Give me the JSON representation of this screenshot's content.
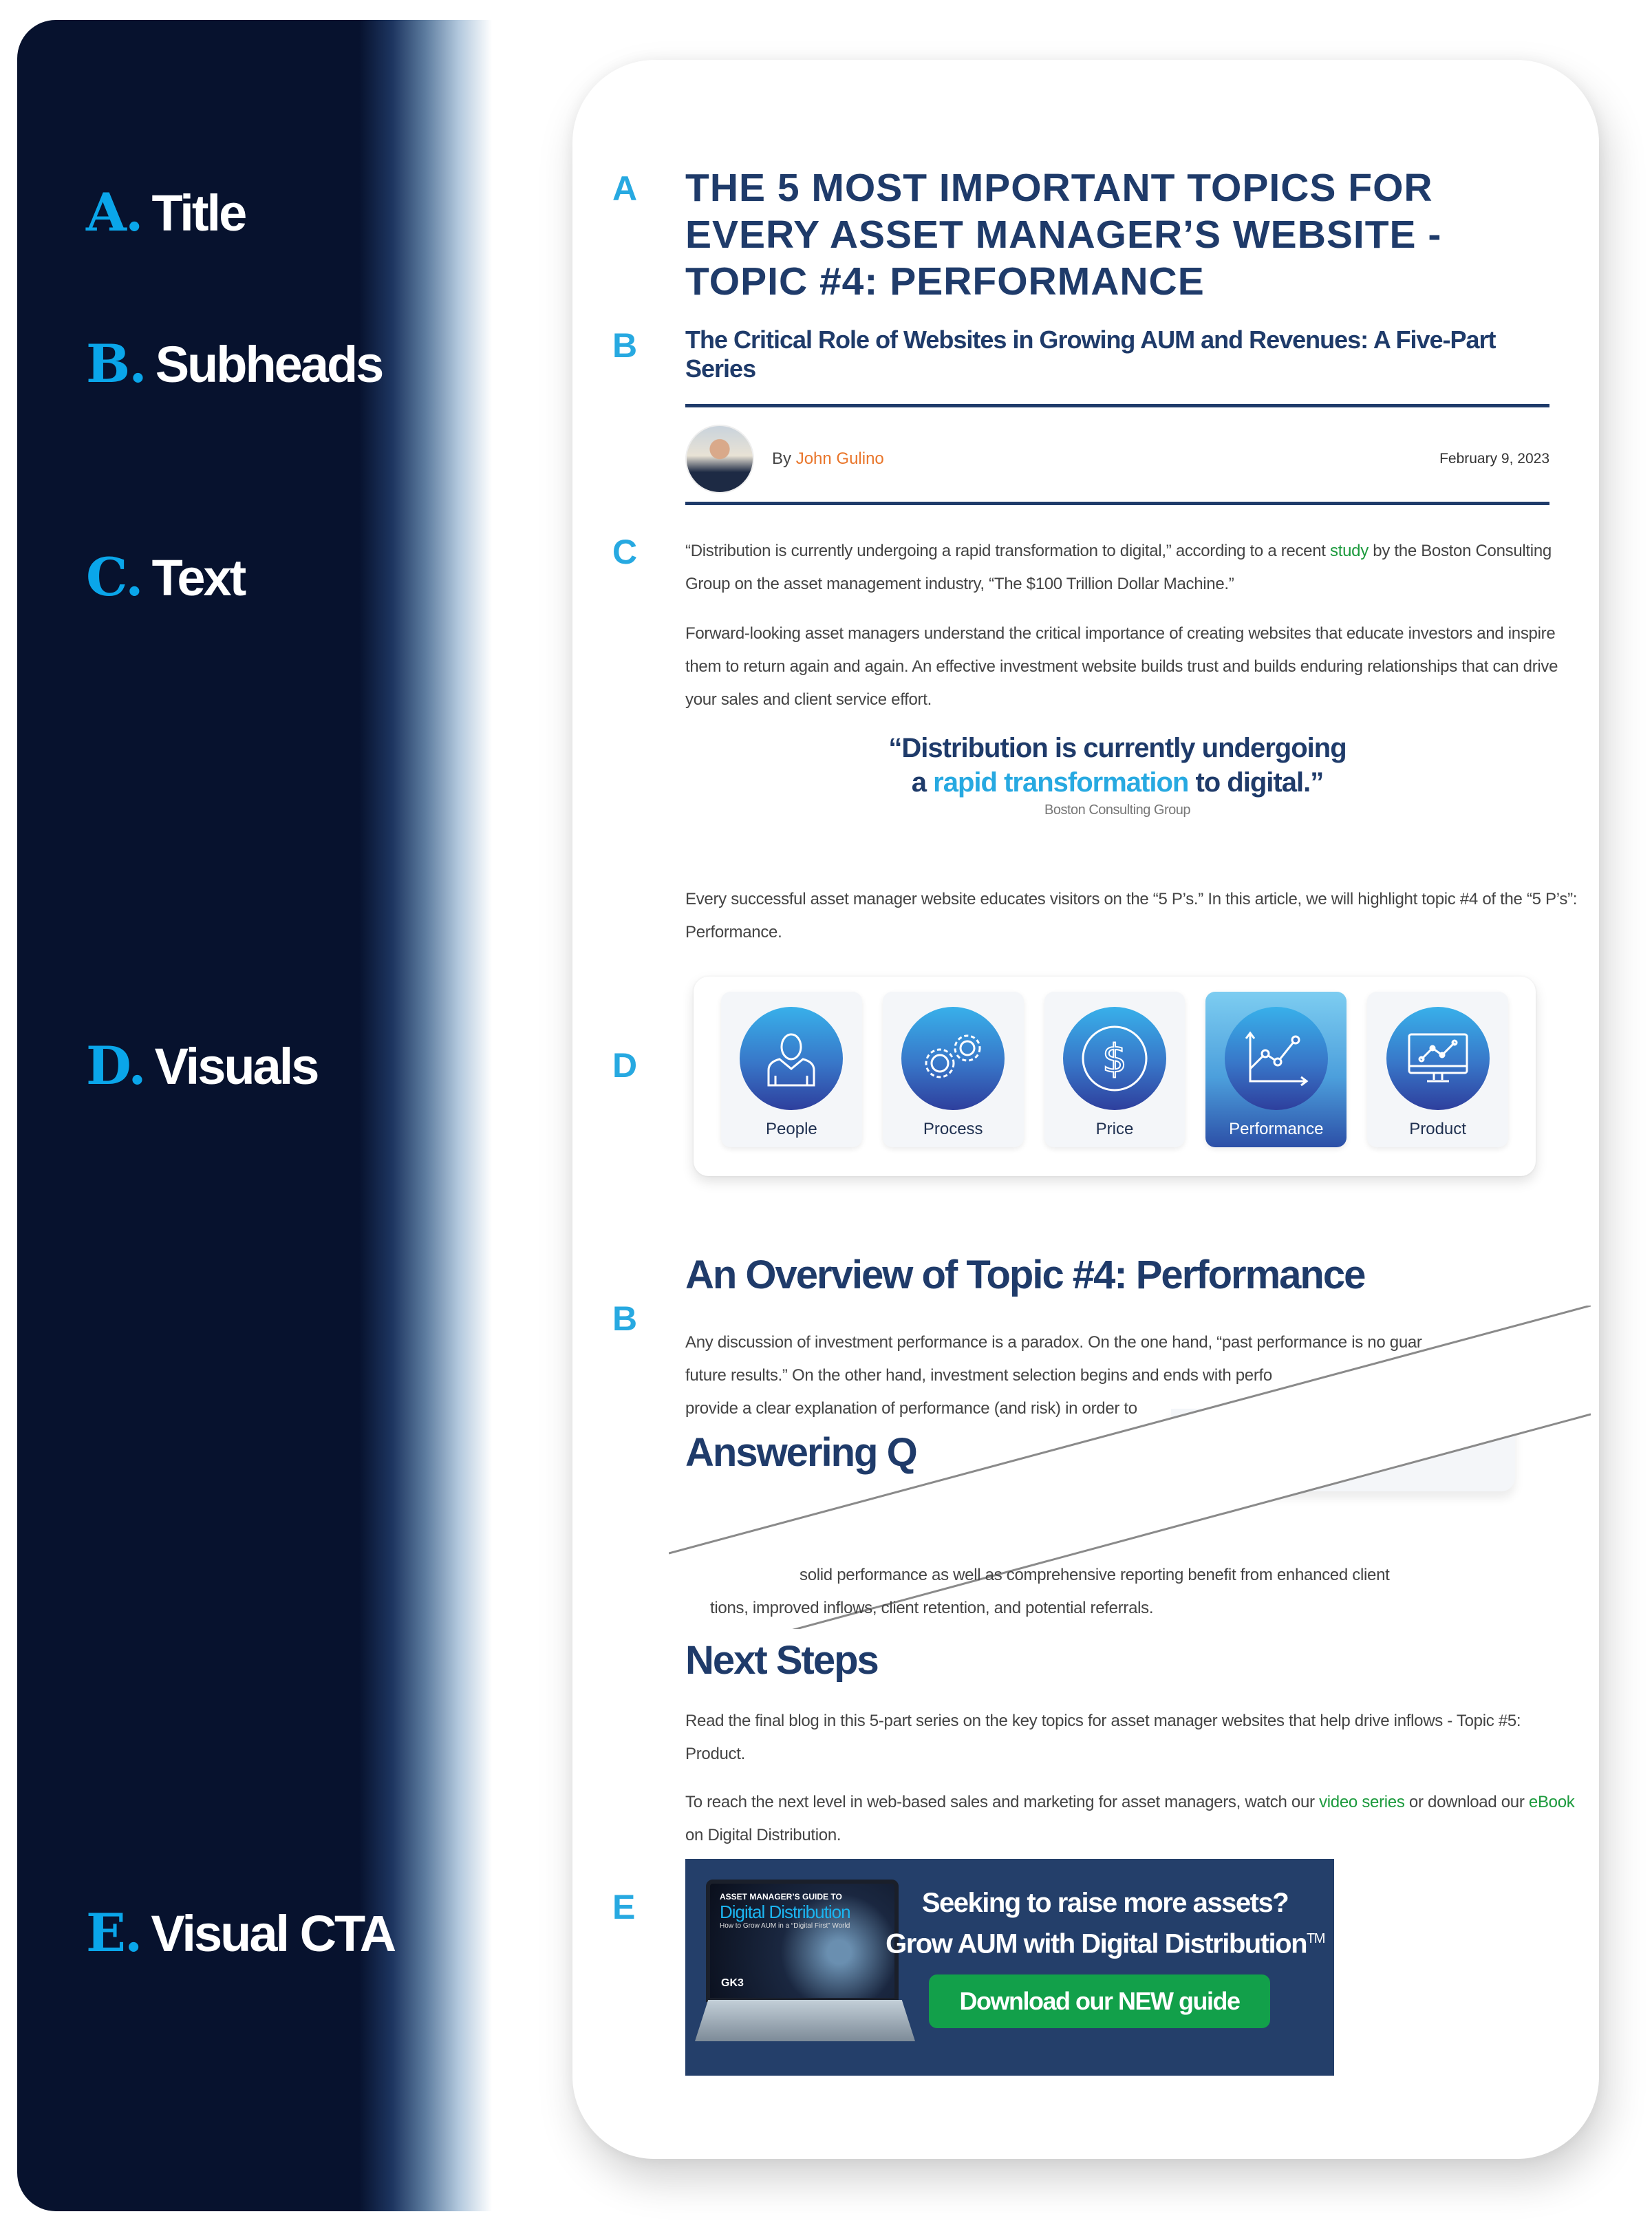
{
  "legend": [
    {
      "letter": "A.",
      "label": "Title"
    },
    {
      "letter": "B.",
      "label": "Subheads"
    },
    {
      "letter": "C.",
      "label": "Text"
    },
    {
      "letter": "D.",
      "label": "Visuals"
    },
    {
      "letter": "E.",
      "label": "Visual CTA"
    }
  ],
  "markers": {
    "a": "A",
    "b1": "B",
    "c": "C",
    "d": "D",
    "b2": "B",
    "e": "E"
  },
  "article": {
    "title": "THE 5 MOST IMPORTANT TOPICS FOR EVERY ASSET MANAGER’S WEBSITE - TOPIC #4: PERFORMANCE",
    "subtitle": "The Critical Role of Websites in Growing AUM and Revenues: A Five-Part Series",
    "byline_prefix": "By",
    "author": "John Gulino",
    "date": "February 9, 2023",
    "intro_p1_before": "“Distribution is currently undergoing a rapid transformation to digital,” according to a recent",
    "intro_p1_link": "study",
    "intro_p1_after": "by the Boston Consulting Group on the asset management industry, “The $100 Trillion Dollar Machine.”",
    "intro_p2": "Forward-looking asset managers understand the critical importance of creating websites that educate investors and inspire them to return again and again. An effective investment website builds trust and builds enduring relationships that can drive your sales and client service effort.",
    "pullquote": {
      "line1": "“Distribution is currently undergoing",
      "line2_pre": "a",
      "line2_accent": "rapid transformation",
      "line2_post": "to digital.”",
      "source": "Boston Consulting Group"
    },
    "five_ps_para": "Every successful asset manager website educates visitors on the “5 P’s.” In this article, we will highlight topic #4 of the “5 P’s”: Performance.",
    "five_ps": [
      {
        "label": "People",
        "icon": "person-icon",
        "active": false
      },
      {
        "label": "Process",
        "icon": "gears-icon",
        "active": false
      },
      {
        "label": "Price",
        "icon": "dollar-icon",
        "active": false
      },
      {
        "label": "Performance",
        "icon": "line-chart-icon",
        "active": true
      },
      {
        "label": "Product",
        "icon": "monitor-chart-icon",
        "active": false
      }
    ],
    "overview_heading": "An Overview of Topic #4: Performance",
    "overview_lines": [
      "Any discussion of investment performance is a paradox. On the one hand, “past performance is no guar",
      "future results.” On the other hand, investment selection begins and ends with perfo",
      "provide a clear explanation of performance (and risk) in order to"
    ],
    "answering_heading": "Answering Q",
    "after_tear_lines": [
      "solid performance as well as comprehensive reporting benefit from enhanced client",
      "tions, improved inflows, client retention, and potential referrals."
    ],
    "next_steps_heading": "Next Steps",
    "next_steps_p1": "Read the final blog in this 5-part series on the key topics for asset manager websites that help drive inflows - Topic #5: Product.",
    "next_steps_p2_before": "To reach the next level in web-based sales and marketing for asset managers, watch our",
    "next_steps_p2_link1": "video series",
    "next_steps_p2_mid": "or download our",
    "next_steps_p2_link2": "eBook",
    "next_steps_p2_after": "on Digital Distribution."
  },
  "cta": {
    "screen_kicker": "ASSET MANAGER’S GUIDE TO",
    "screen_title": "Digital Distribution",
    "screen_subtitle": "How to Grow AUM in a “Digital First” World",
    "screen_logo": "GK3",
    "headline1": "Seeking to raise more assets?",
    "headline2": "Grow AUM with Digital Distribution",
    "trademark": "TM",
    "button_label": "Download our NEW guide"
  },
  "colors": {
    "navy": "#1f3b6a",
    "accent_blue": "#27a9e1",
    "link_green": "#1c9a3d",
    "author_orange": "#e9752a",
    "cta_bg": "#243f6a",
    "cta_button": "#12a04a"
  }
}
